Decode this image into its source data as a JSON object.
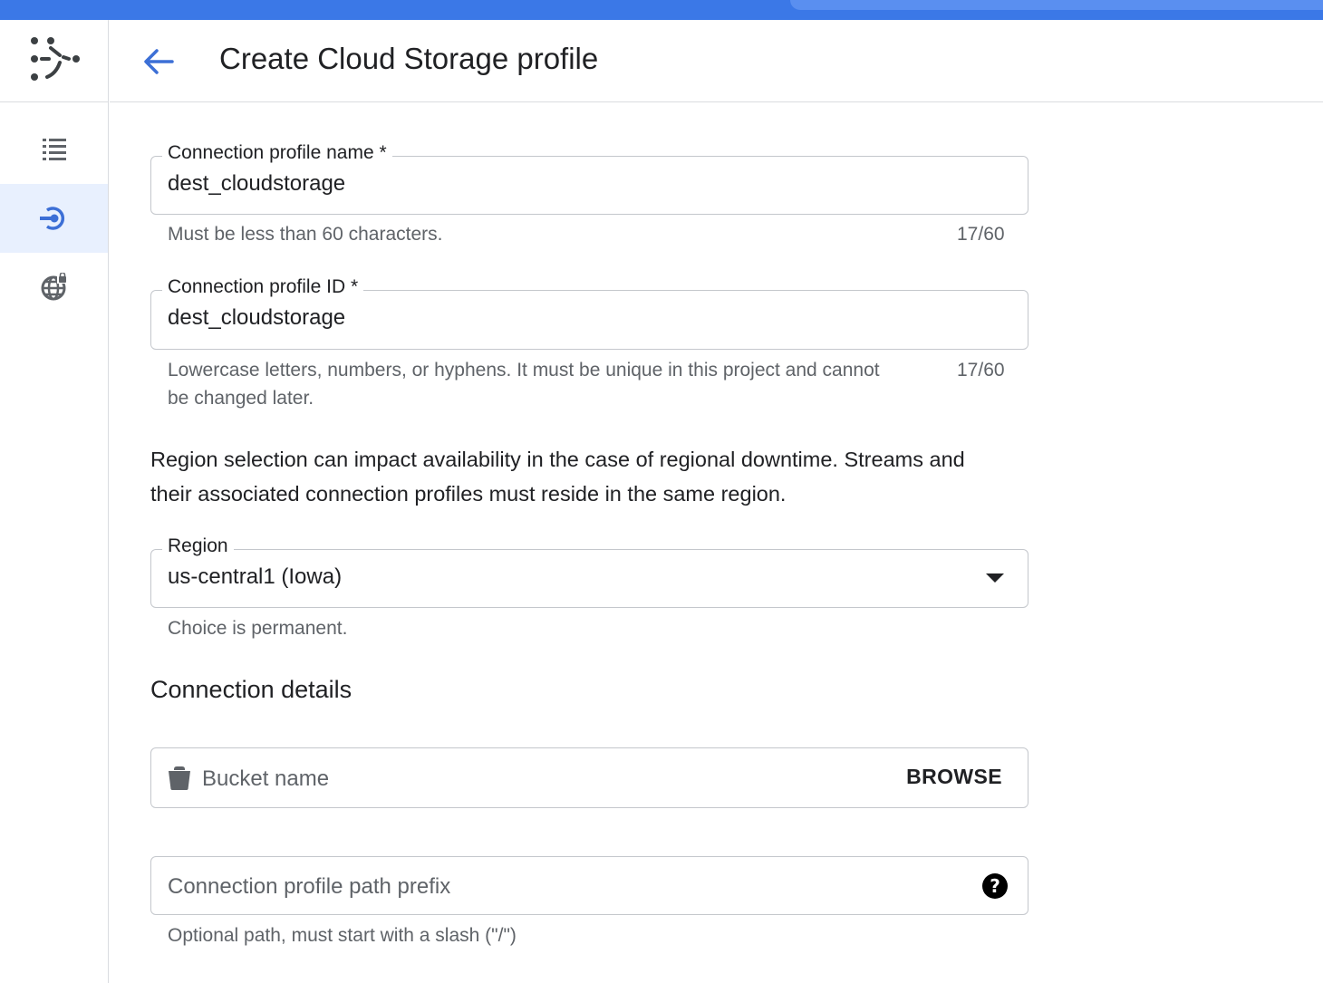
{
  "header": {
    "title": "Create Cloud Storage profile"
  },
  "rail": {
    "items": [
      {
        "name": "list-icon",
        "active": false
      },
      {
        "name": "connection-profile-icon",
        "active": true
      },
      {
        "name": "private-connectivity-icon",
        "active": false
      }
    ]
  },
  "form": {
    "profile_name": {
      "label": "Connection profile name *",
      "value": "dest_cloudstorage",
      "hint": "Must be less than 60 characters.",
      "counter": "17/60"
    },
    "profile_id": {
      "label": "Connection profile ID *",
      "value": "dest_cloudstorage",
      "hint_line1": "Lowercase letters, numbers, or hyphens. It must be unique in this project and cannot",
      "hint_line2": "be changed later.",
      "counter": "17/60"
    },
    "region_info": {
      "line1": "Region selection can impact availability in the case of regional downtime. Streams and",
      "line2": "their associated connection profiles must reside in the same region."
    },
    "region": {
      "label": "Region",
      "value": "us-central1 (Iowa)",
      "hint": "Choice is permanent."
    },
    "connection_details": {
      "title": "Connection details",
      "bucket": {
        "placeholder": "Bucket name",
        "browse_label": "BROWSE"
      },
      "path_prefix": {
        "placeholder": "Connection profile path prefix",
        "help_glyph": "?",
        "hint": "Optional path, must start with a slash (\"/\")"
      }
    }
  },
  "colors": {
    "topbar": "#3b78e7",
    "accent": "#3c6fd6",
    "active_bg": "#e8f0fe",
    "border": "#c4c7cc"
  }
}
